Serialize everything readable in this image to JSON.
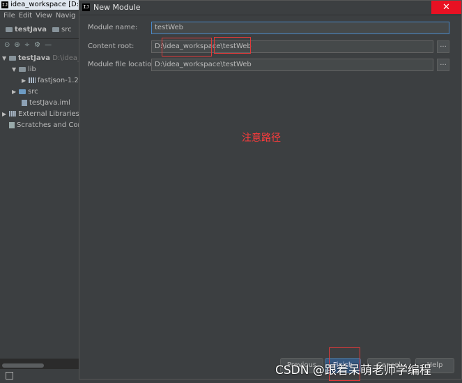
{
  "ide": {
    "title": "idea_workspace [D:\\idea",
    "logo_text": "IJ",
    "menu": [
      "File",
      "Edit",
      "View",
      "Navig"
    ],
    "breadcrumb": [
      "testJava",
      "src"
    ],
    "toolbar_icons": [
      "scope-icon",
      "sync-icon",
      "expand-icon",
      "collapse-icon",
      "settings-icon"
    ],
    "toolbar_glyphs": [
      "⊙",
      "⊕",
      "÷",
      "⚙",
      "—"
    ],
    "tree": {
      "root_label": "testJava",
      "root_path": "D:\\idea_",
      "lib_label": "lib",
      "jar_label": "fastjson-1.2.",
      "src_label": "src",
      "iml_label": "testJava.iml",
      "ext_label": "External Libraries",
      "scratch_label": "Scratches and Cor"
    }
  },
  "dialog": {
    "title": "New Module",
    "logo_text": "IJ",
    "close_glyph": "✕",
    "labels": {
      "module_name": "Module name:",
      "content_root": "Content root:",
      "module_file": "Module file location:"
    },
    "values": {
      "module_name": "testWeb",
      "content_root": "D:\\idea_workspace\\testWeb",
      "module_file": "D:\\idea_workspace\\testWeb"
    },
    "browse_label": "...",
    "note": "注意路径",
    "buttons": {
      "previous": "Previous",
      "finish": "Finish",
      "cancel": "Cancel",
      "help": "Help"
    }
  },
  "watermark": "CSDN @跟着呆萌老师学编程"
}
